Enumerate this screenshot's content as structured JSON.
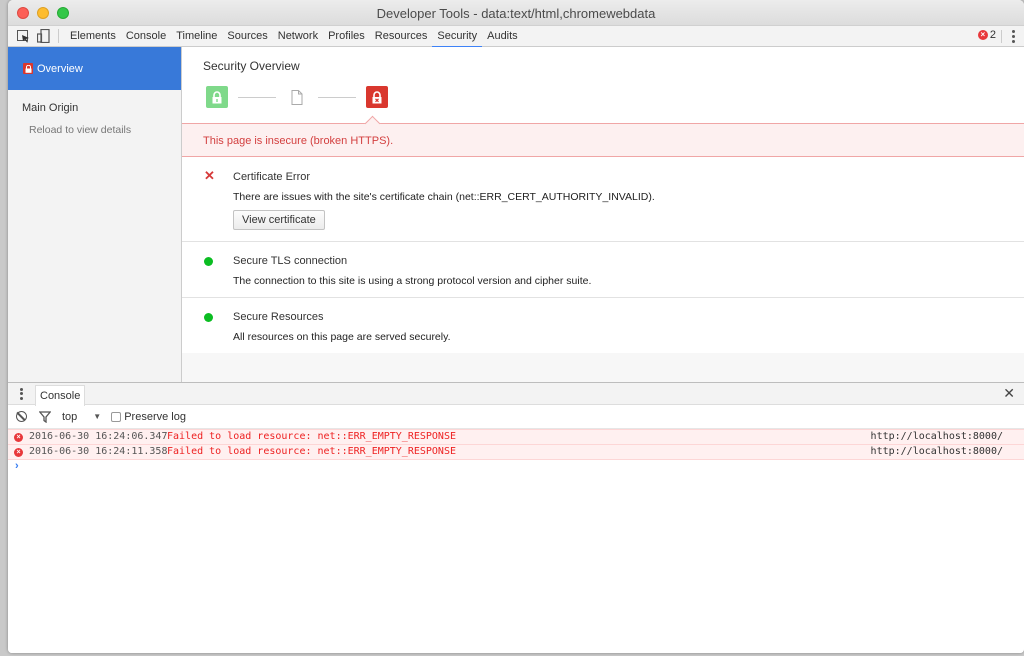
{
  "window": {
    "title": "Developer Tools - data:text/html,chromewebdata"
  },
  "toolbar": {
    "inspect_icon": "inspect-element-icon",
    "device_icon": "device-mode-icon",
    "tabs": [
      {
        "label": "Elements",
        "active": false
      },
      {
        "label": "Console",
        "active": false
      },
      {
        "label": "Timeline",
        "active": false
      },
      {
        "label": "Sources",
        "active": false
      },
      {
        "label": "Network",
        "active": false
      },
      {
        "label": "Profiles",
        "active": false
      },
      {
        "label": "Resources",
        "active": false
      },
      {
        "label": "Security",
        "active": true
      },
      {
        "label": "Audits",
        "active": false
      }
    ],
    "error_count": "2",
    "error_glyph": "×",
    "menu_icon": "kebab-menu-icon"
  },
  "sidebar": {
    "overview_label": "Overview",
    "main_origin_label": "Main Origin",
    "reload_hint": "Reload to view details"
  },
  "security": {
    "title": "Security Overview",
    "chain": [
      {
        "state": "secure",
        "icon": "lock-icon",
        "color": "#7fd98a"
      },
      {
        "state": "neutral",
        "icon": "document-icon",
        "color": "#bbbbbb"
      },
      {
        "state": "insecure",
        "icon": "broken-lock-icon",
        "color": "#d9372e"
      }
    ],
    "banner_text": "This page is insecure (broken HTTPS).",
    "sections": [
      {
        "status": "error",
        "status_glyph": "✕",
        "title": "Certificate Error",
        "description": "There are issues with the site's certificate chain (net::ERR_CERT_AUTHORITY_INVALID).",
        "button_label": "View certificate"
      },
      {
        "status": "secure",
        "title": "Secure TLS connection",
        "description": "The connection to this site is using a strong protocol version and cipher suite."
      },
      {
        "status": "secure",
        "title": "Secure Resources",
        "description": "All resources on this page are served securely."
      }
    ]
  },
  "drawer": {
    "tab_label": "Console",
    "close_glyph": "✕",
    "context_label": "top",
    "context_arrow": "▼",
    "preserve_log_label": "Preserve log",
    "preserve_log_checked": false,
    "messages": [
      {
        "level": "error",
        "glyph": "×",
        "timestamp": "2016-06-30 16:24:06.347",
        "text": "Failed to load resource: net::ERR_EMPTY_RESPONSE",
        "source": "http://localhost:8000/"
      },
      {
        "level": "error",
        "glyph": "×",
        "timestamp": "2016-06-30 16:24:11.358",
        "text": "Failed to load resource: net::ERR_EMPTY_RESPONSE",
        "source": "http://localhost:8000/"
      }
    ],
    "prompt_glyph": "›"
  },
  "colors": {
    "accent": "#3879d9",
    "error": "#d33f3f",
    "secure": "#0bbd22"
  }
}
